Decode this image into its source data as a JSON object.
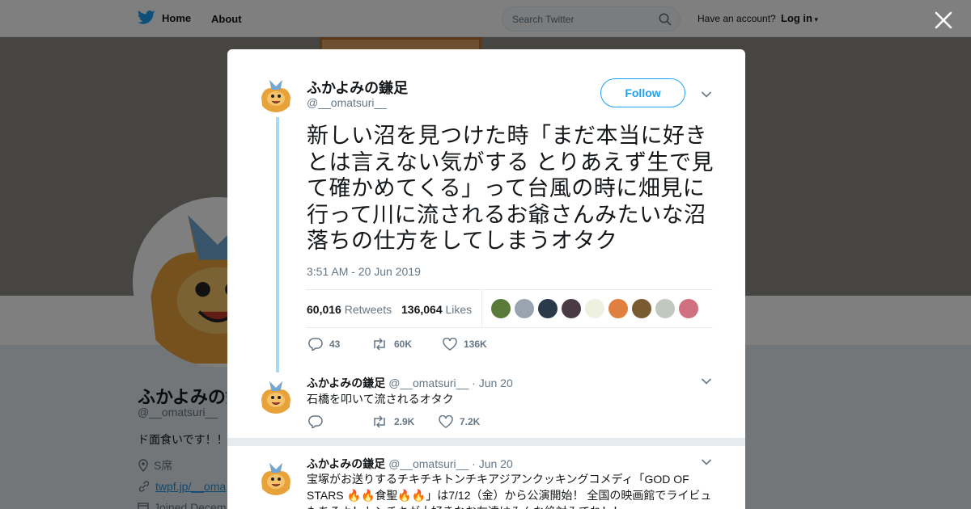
{
  "topbar": {
    "home_label": "Home",
    "about_label": "About",
    "search_placeholder": "Search Twitter",
    "account_text": "Have an account?",
    "login_label": "Log in"
  },
  "profile": {
    "name": "ふかよみの鎌足",
    "handle": "@__omatsuri__",
    "bio": "ド面食いです！！",
    "location": "S席",
    "url": "twpf.jp/__oma",
    "joined": "Joined Decem"
  },
  "tweet": {
    "author_name": "ふかよみの鎌足",
    "author_handle": "@__omatsuri__",
    "follow_label": "Follow",
    "text": "新しい沼を見つけた時「まだ本当に好きとは言えない気がする とりあえず生で見て確かめてくる」って台風の時に畑見に行って川に流されるお爺さんみたいな沼落ちの仕方をしてしまうオタク",
    "timestamp": "3:51 AM - 20 Jun 2019",
    "retweets_count": "60,016",
    "retweets_label": "Retweets",
    "likes_count": "136,064",
    "likes_label": "Likes",
    "liker_colors": [
      "#5a7a3a",
      "#9aa4b0",
      "#2a3a4a",
      "#4a3a44",
      "#f0f0e0",
      "#e08040",
      "#7a5a30",
      "#c0c8c0",
      "#d07080"
    ],
    "actions": {
      "reply": "43",
      "retweet": "60K",
      "like": "136K"
    }
  },
  "replies": [
    {
      "name": "ふかよみの鎌足",
      "handle": "@__omatsuri__",
      "date": "Jun 20",
      "text": "石橋を叩いて流されるオタク",
      "actions": {
        "reply": "",
        "retweet": "2.9K",
        "like": "7.2K"
      }
    },
    {
      "name": "ふかよみの鎌足",
      "handle": "@__omatsuri__",
      "date": "Jun 20",
      "text": "宝塚がお送りするチキチキトンチキアジアンクッキングコメディ「GOD OF STARS 🔥🔥食聖🔥🔥」は7/12（金）から公演開始！ 全国の映画館でライビュもあるよ！トンチキが大好きなお友達はみんな絶対みてね！！"
    }
  ],
  "colors": {
    "accent": "#1da1f2",
    "thread_line": "#a9d8f2",
    "muted": "#657786"
  }
}
